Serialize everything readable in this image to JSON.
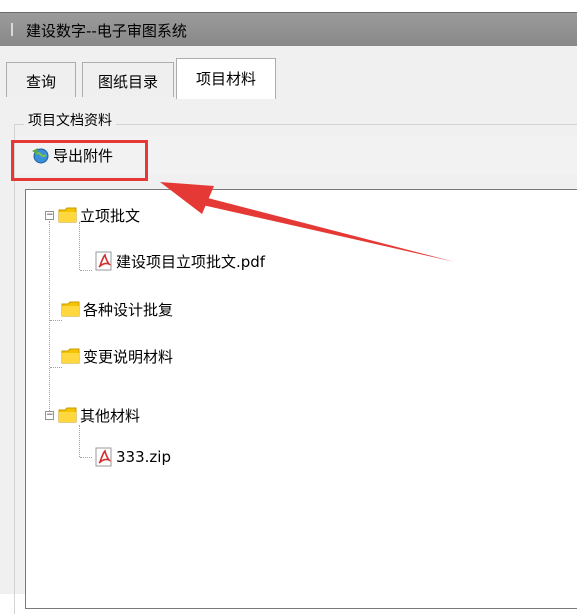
{
  "window": {
    "title": "建设数字--电子审图系统"
  },
  "tabs": [
    {
      "label": "查询",
      "active": false
    },
    {
      "label": "图纸目录",
      "active": false
    },
    {
      "label": "项目材料",
      "active": true
    }
  ],
  "group": {
    "label": "项目文档资料"
  },
  "toolbar": {
    "export_label": "导出附件",
    "export_icon": "export-globe-icon"
  },
  "tree": [
    {
      "label": "立项批文",
      "type": "folder",
      "expanded": true,
      "children": [
        {
          "label": "建设项目立项批文.pdf",
          "type": "pdf"
        }
      ]
    },
    {
      "label": "各种设计批复",
      "type": "folder"
    },
    {
      "label": "变更说明材料",
      "type": "folder"
    },
    {
      "label": "其他材料",
      "type": "folder",
      "expanded": true,
      "children": [
        {
          "label": "333.zip",
          "type": "pdf"
        }
      ]
    }
  ],
  "colors": {
    "highlight": "#e53935",
    "folder": "#f5c400",
    "titlebar": "#909090"
  }
}
